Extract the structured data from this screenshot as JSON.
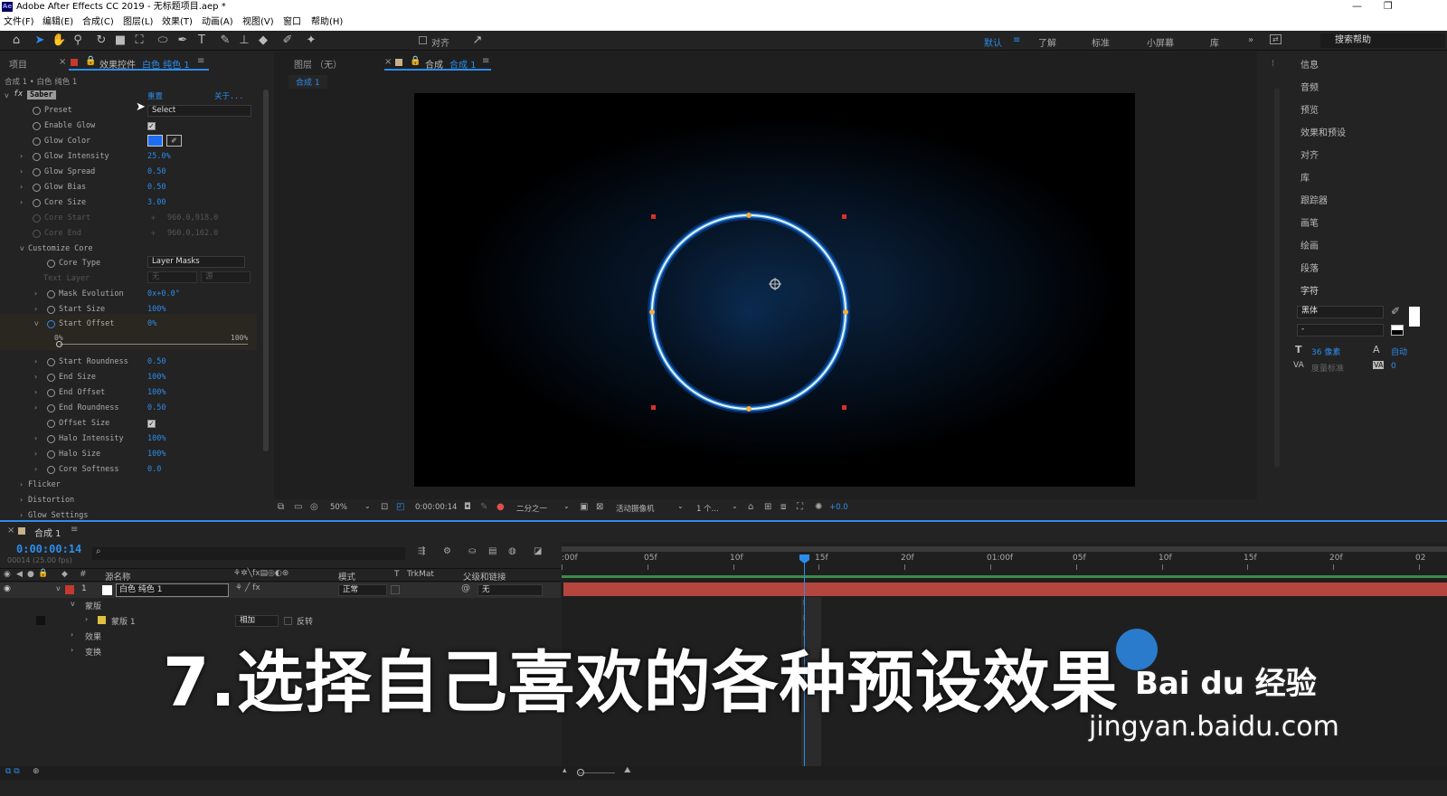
{
  "window": {
    "title": "Adobe After Effects CC 2019 - 无标题项目.aep *",
    "app_icon": "Ae"
  },
  "menu": [
    "文件(F)",
    "编辑(E)",
    "合成(C)",
    "图层(L)",
    "效果(T)",
    "动画(A)",
    "视图(V)",
    "窗口",
    "帮助(H)"
  ],
  "toolbar": {
    "align_label": "对齐",
    "workspaces": [
      "默认",
      "了解",
      "标准",
      "小屏幕",
      "库"
    ],
    "search_placeholder": "搜索帮助"
  },
  "left_panel": {
    "tab_project": "项目",
    "tab_effects_prefix": "效果控件",
    "tab_effects_layer": "白色 纯色 1",
    "breadcrumb": "合成 1 • 白色 纯色 1",
    "fx_label": "fx",
    "effect_name": "Saber",
    "reset": "重置",
    "about": "关于...",
    "props": [
      {
        "name": "Preset",
        "value": "Select",
        "kind": "dropdown"
      },
      {
        "name": "Enable Glow",
        "kind": "checkbox"
      },
      {
        "name": "Glow Color",
        "kind": "color"
      },
      {
        "name": "Glow Intensity",
        "value": "25.0%"
      },
      {
        "name": "Glow Spread",
        "value": "0.50"
      },
      {
        "name": "Glow Bias",
        "value": "0.50"
      },
      {
        "name": "Core Size",
        "value": "3.00"
      },
      {
        "name": "Core Start",
        "value": "960.0,918.0",
        "disabled": true
      },
      {
        "name": "Core End",
        "value": "960.0,162.0",
        "disabled": true
      }
    ],
    "customize_core": "Customize Core",
    "core_props": [
      {
        "name": "Core Type",
        "value": "Layer Masks",
        "kind": "dropdown"
      },
      {
        "name": "Text Layer",
        "value": "无",
        "value2": "源",
        "disabled": true
      },
      {
        "name": "Mask Evolution",
        "value": "0x+0.0°"
      },
      {
        "name": "Start Size",
        "value": "100%"
      },
      {
        "name": "Start Offset",
        "value": "0%"
      }
    ],
    "slider": {
      "min": "0%",
      "max": "100%",
      "value": 0
    },
    "core_props2": [
      {
        "name": "Start Roundness",
        "value": "0.50"
      },
      {
        "name": "End Size",
        "value": "100%"
      },
      {
        "name": "End Offset",
        "value": "100%"
      },
      {
        "name": "End Roundness",
        "value": "0.50"
      },
      {
        "name": "Offset Size",
        "kind": "checkbox"
      },
      {
        "name": "Halo Intensity",
        "value": "100%"
      },
      {
        "name": "Halo Size",
        "value": "100%"
      },
      {
        "name": "Core Softness",
        "value": "0.0"
      }
    ],
    "groups": [
      "Flicker",
      "Distortion",
      "Glow Settings"
    ]
  },
  "viewer": {
    "tab_layer": "图层 （无）",
    "tab_comp_prefix": "合成",
    "tab_comp_name": "合成 1",
    "sub_tab": "合成 1",
    "bottom": {
      "zoom": "50%",
      "time": "0:00:00:14",
      "resolution": "二分之一",
      "camera": "活动摄像机",
      "views": "1 个...",
      "exposure": "+0.0"
    }
  },
  "right_panel": {
    "items": [
      "信息",
      "音频",
      "预览",
      "效果和预设",
      "对齐",
      "库",
      "跟踪器",
      "画笔",
      "绘画",
      "段落",
      "字符"
    ],
    "font": "黑体",
    "style": "-",
    "font_size": "36 像素",
    "leading": "自动",
    "tracking_label": "度量标准",
    "tracking_value": "0"
  },
  "timeline": {
    "tab": "合成 1",
    "timecode": "0:00:00:14",
    "fps": "00014 (25.00 fps)",
    "col_source": "源名称",
    "col_mode": "模式",
    "col_t": "T",
    "col_trkmat": "TrkMat",
    "col_parent": "父级和链接",
    "layer": {
      "index": "1",
      "name": "白色 纯色 1",
      "mode": "正常",
      "parent": "无"
    },
    "masks_label": "蒙版",
    "mask1": "蒙版 1",
    "mask_mode": "相加",
    "invert": "反转",
    "effects": "效果",
    "transform": "变换",
    "ruler": [
      ":00f",
      "05f",
      "10f",
      "15f",
      "20f",
      "01:00f",
      "05f",
      "10f",
      "15f",
      "20f",
      "02"
    ]
  },
  "overlay": {
    "text": "7.选择自己喜欢的各种预设效果",
    "watermark_brand": "Bai du 经验",
    "watermark_url": "jingyan.baidu.com"
  },
  "colors": {
    "accent": "#2d8ceb",
    "layer_bar": "#b4463f",
    "glow": "#3aa0ff"
  }
}
